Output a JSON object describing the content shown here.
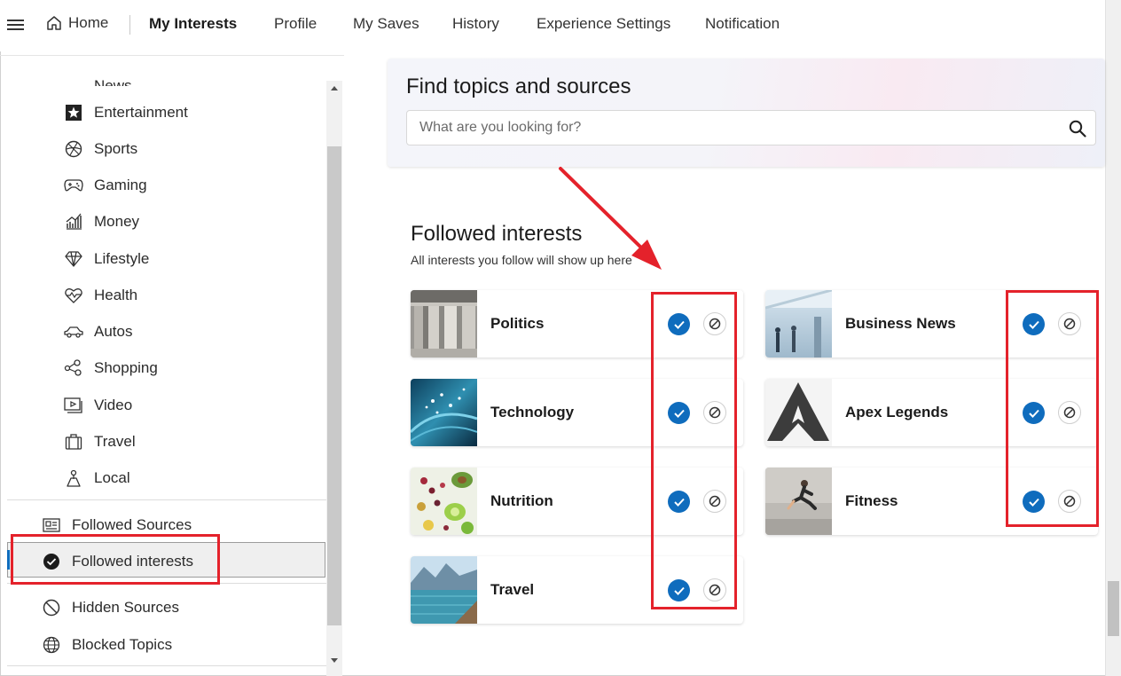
{
  "topnav": {
    "home": "Home",
    "items": [
      "My Interests",
      "Profile",
      "My Saves",
      "History",
      "Experience Settings",
      "Notification"
    ]
  },
  "sidebar": {
    "partial_item": "News",
    "categories": [
      {
        "label": "Entertainment",
        "icon": "star-icon"
      },
      {
        "label": "Sports",
        "icon": "ball-icon"
      },
      {
        "label": "Gaming",
        "icon": "gamepad-icon"
      },
      {
        "label": "Money",
        "icon": "chart-icon"
      },
      {
        "label": "Lifestyle",
        "icon": "diamond-icon"
      },
      {
        "label": "Health",
        "icon": "heart-icon"
      },
      {
        "label": "Autos",
        "icon": "car-icon"
      },
      {
        "label": "Shopping",
        "icon": "shopping-icon"
      },
      {
        "label": "Video",
        "icon": "video-icon"
      },
      {
        "label": "Travel",
        "icon": "suitcase-icon"
      },
      {
        "label": "Local",
        "icon": "location-icon"
      }
    ],
    "manage": [
      {
        "label": "Followed Sources",
        "icon": "newspaper-icon"
      },
      {
        "label": "Followed interests",
        "icon": "check-circle-icon"
      },
      {
        "label": "Hidden Sources",
        "icon": "hidden-icon"
      },
      {
        "label": "Blocked Topics",
        "icon": "globe-icon"
      }
    ]
  },
  "find": {
    "title": "Find topics and sources",
    "placeholder": "What are you looking for?"
  },
  "followed": {
    "title": "Followed interests",
    "subtitle": "All interests you follow will show up here",
    "left": [
      "Politics",
      "Technology",
      "Nutrition",
      "Travel"
    ],
    "right": [
      "Business News",
      "Apex Legends",
      "Fitness"
    ]
  },
  "colors": {
    "accent": "#0f6cbd",
    "annotation": "#e4222b"
  }
}
